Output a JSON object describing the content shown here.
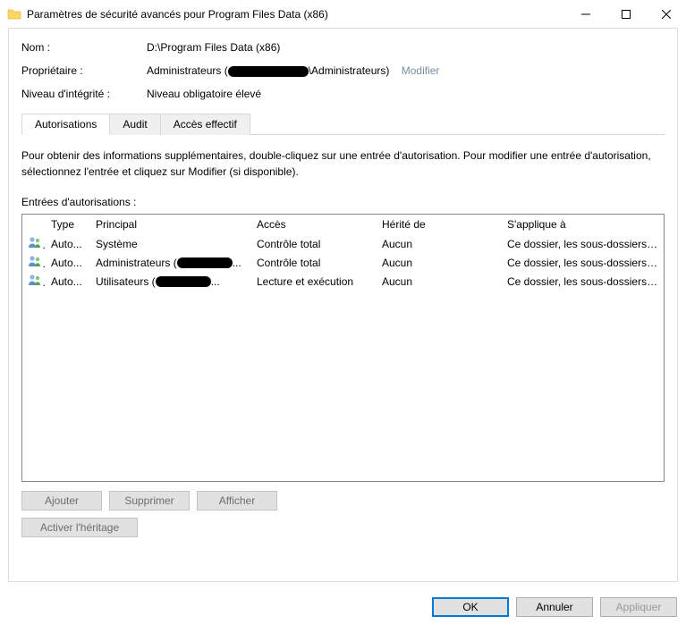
{
  "window": {
    "title": "Paramètres de sécurité avancés pour Program Files Data (x86)"
  },
  "info": {
    "name_label": "Nom :",
    "name_value": "D:\\Program Files Data (x86)",
    "owner_label": "Propriétaire :",
    "owner_prefix": "Administrateurs (",
    "owner_suffix": "\\Administrateurs)",
    "modify": "Modifier",
    "integrity_label": "Niveau d'intégrité :",
    "integrity_value": "Niveau obligatoire élevé"
  },
  "tabs": {
    "permissions": "Autorisations",
    "audit": "Audit",
    "effective": "Accès effectif"
  },
  "instruction": "Pour obtenir des informations supplémentaires, double-cliquez sur une entrée d'autorisation. Pour modifier une entrée d'autorisation, sélectionnez l'entrée et cliquez sur Modifier (si disponible).",
  "entries_label": "Entrées d'autorisations :",
  "columns": {
    "type": "Type",
    "principal": "Principal",
    "access": "Accès",
    "inherited": "Hérité de",
    "applies": "S'applique à"
  },
  "rows": [
    {
      "type": "Auto...",
      "principal_text": "Système",
      "principal_redacted": false,
      "access": "Contrôle total",
      "inherited": "Aucun",
      "applies": "Ce dossier, les sous-dossiers e..."
    },
    {
      "type": "Auto...",
      "principal_prefix": "Administrateurs (",
      "principal_redacted": true,
      "principal_suffix": "...",
      "access": "Contrôle total",
      "inherited": "Aucun",
      "applies": "Ce dossier, les sous-dossiers e..."
    },
    {
      "type": "Auto...",
      "principal_prefix": "Utilisateurs (",
      "principal_redacted": true,
      "principal_suffix": "...",
      "access": "Lecture et exécution",
      "inherited": "Aucun",
      "applies": "Ce dossier, les sous-dossiers e..."
    }
  ],
  "buttons": {
    "add": "Ajouter",
    "remove": "Supprimer",
    "view": "Afficher",
    "enable_inherit": "Activer l'héritage",
    "ok": "OK",
    "cancel": "Annuler",
    "apply": "Appliquer"
  }
}
